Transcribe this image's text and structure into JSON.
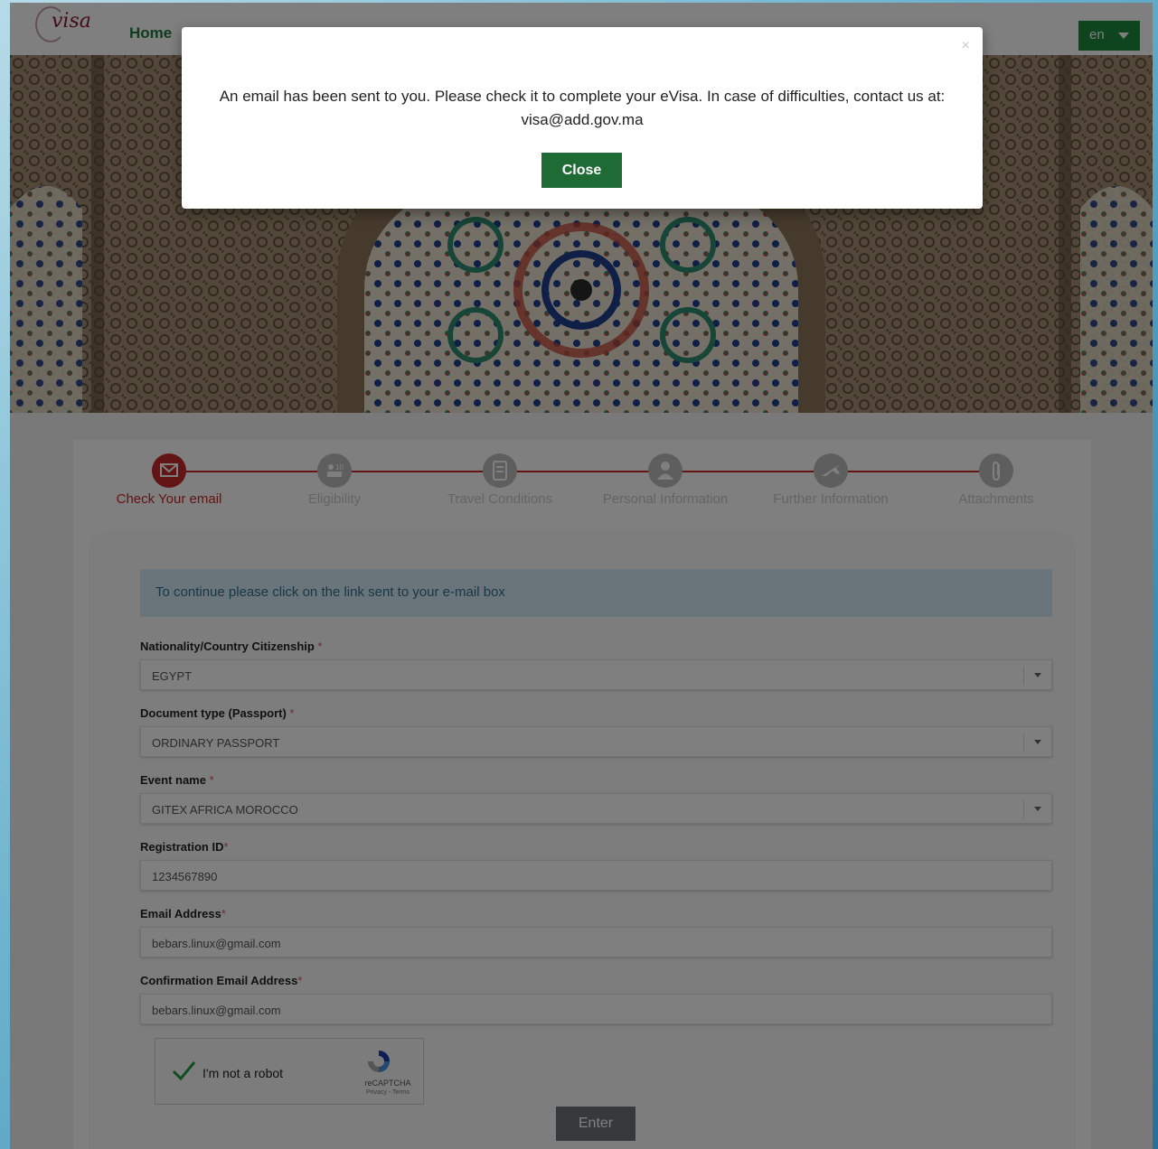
{
  "header": {
    "logo_text": "visa",
    "nav_home": "Home",
    "language": "en"
  },
  "steps": [
    {
      "label": "Check Your email",
      "icon": "envelope-icon",
      "active": true
    },
    {
      "label": "Eligibility",
      "icon": "eligibility-icon",
      "active": false
    },
    {
      "label": "Travel Conditions",
      "icon": "document-icon",
      "active": false
    },
    {
      "label": "Personal Information",
      "icon": "person-icon",
      "active": false
    },
    {
      "label": "Further Information",
      "icon": "plane-icon",
      "active": false
    },
    {
      "label": "Attachments",
      "icon": "paperclip-icon",
      "active": false
    }
  ],
  "form": {
    "alert": "To continue please click on the link sent to your e-mail box",
    "fields": [
      {
        "label": "Nationality/Country Citizenship",
        "value": "EGYPT",
        "type": "select"
      },
      {
        "label": "Document type (Passport)",
        "value": "ORDINARY PASSPORT",
        "type": "select"
      },
      {
        "label": "Event name",
        "value": "GITEX AFRICA MOROCCO",
        "type": "select"
      },
      {
        "label": "Registration ID",
        "value": "1234567890",
        "type": "input"
      },
      {
        "label": "Email Address",
        "value": "bebars.linux@gmail.com",
        "type": "input"
      },
      {
        "label": "Confirmation Email Address",
        "value": "bebars.linux@gmail.com",
        "type": "input"
      }
    ],
    "required_mark": "*",
    "captcha": {
      "label": "I'm not a robot",
      "brand": "reCAPTCHA",
      "links": "Privacy - Terms",
      "checked": true
    },
    "submit_label": "Enter"
  },
  "modal": {
    "message": "An email has been sent to you. Please check it to complete your eVisa. In case of difficulties, contact us at: visa@add.gov.ma",
    "close_label": "Close",
    "close_x": "×"
  },
  "colors": {
    "brand_green": "#1e7a3c",
    "step_active": "#c62828",
    "step_inactive": "#bdbdbd",
    "alert_bg": "#d4e9f6"
  }
}
